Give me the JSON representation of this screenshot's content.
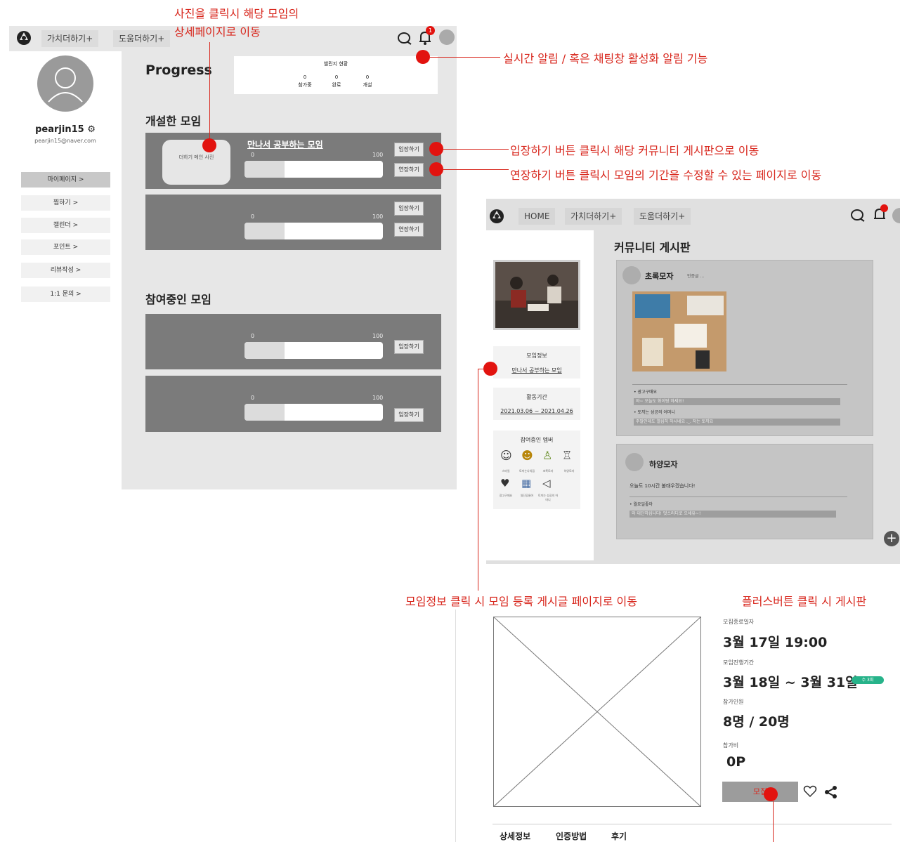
{
  "annotations": {
    "photo_click": "사진을 클릭시 해당 모임의\n상세페이지로 이동",
    "realtime_alert": "실시간 알림 / 혹은 채팅창 활성화 알림 기능",
    "enter_btn": "입장하기 버튼 클릭시 해당 커뮤니티 게시판으로 이동",
    "extend_btn": "연장하기 버튼 클릭시 모임의 기간을 수정할 수 있는 페이지로 이동",
    "group_info": "모임정보 클릭 시 모임 등록 게시글 페이지로 이동",
    "plus_btn": "플러스버튼 클릭 시 게시판"
  },
  "screen1": {
    "nav": [
      "가치더하기+",
      "도움더하기+"
    ],
    "notif_badge": "1",
    "user": {
      "name": "pearjin15 ⚙",
      "email": "pearjin15@naver.com"
    },
    "sidebar": [
      "마이페이지 >",
      "찜하기 >",
      "캘린더 >",
      "포인트 >",
      "리뷰작성 >",
      "1:1 문의 >"
    ],
    "progress_title": "Progress",
    "challenge": {
      "title": "챌린지 현황",
      "stats": [
        {
          "value": "0",
          "label": "참가중"
        },
        {
          "value": "0",
          "label": "완료"
        },
        {
          "value": "0",
          "label": "개설"
        }
      ]
    },
    "created_title": "개설한 모임",
    "joined_title": "참여중인 모임",
    "photo_placeholder": "더하기 메인 사진",
    "group_name": "만나서 공부하는 모임",
    "prog_min": "0",
    "prog_max": "100",
    "progress_fraction": 0.29,
    "enter_label": "입장하기",
    "extend_label": "연장하기"
  },
  "screen2": {
    "nav": [
      "HOME",
      "가치더하기+",
      "도움더하기+"
    ],
    "board_title": "커뮤니티 게시판",
    "group_info_label": "모임정보",
    "group_name": "만나서 공부하는 모임",
    "period_label": "활동기간",
    "period": "2021.03.06 ~ 2021.04.26",
    "members_label": "참여중인 멤버",
    "members": [
      "스마일",
      "토끼는나의꿈",
      "초록모자",
      "하양모자",
      "광고구매요",
      "일단공들어",
      "토끼는 성공의 어머니"
    ],
    "posts": [
      {
        "author": "초록모자",
        "tag": "인증글 ...",
        "items": [
          "• 광고구매요",
          "와~ 오늘도 화이팅 하세요!",
          "• 토끼는 성공의 어머니",
          "주말인데도 열심히 하시네요 ._. 저는 토끼요"
        ]
      },
      {
        "author": "하양모자",
        "body": "오늘도 10시간 불태우겠습니다!",
        "items": [
          "• 월요일좋아",
          "와 대단하십니다! 멋스러디로 오세유~!"
        ]
      }
    ],
    "plus": "+"
  },
  "screen3": {
    "end_label": "모집종료일자",
    "end_value": "3월 17일 19:00",
    "period_label": "모임진행기간",
    "period_value": "3월 18일 ~ 3월 31일",
    "period_badge": "수 3회",
    "people_label": "참가인원",
    "people_value": "8명 / 20명",
    "fee_label": "참가비",
    "fee_value": "0P",
    "apply_label": "모집",
    "tabs": [
      "상세정보",
      "인증방법",
      "후기"
    ]
  }
}
